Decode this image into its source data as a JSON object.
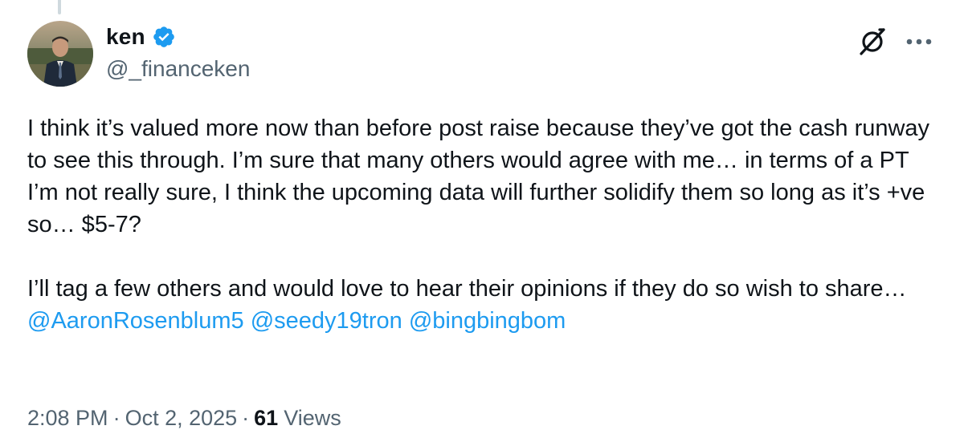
{
  "author": {
    "display_name": "ken",
    "handle": "@_financeken",
    "verified": true
  },
  "tweet": {
    "paragraph1": "I think it’s valued more now than before post raise because they’ve got the cash runway to see this through. I’m sure that many others would agree with me… in terms of a PT I’m not really sure, I think the upcoming data will further solidify them so long as it’s +ve so… $5-7?",
    "paragraph2_text": "I’ll tag a few others and would love to hear their opinions if they do so wish to share… ",
    "mentions": [
      "@AaronRosenblum5",
      "@seedy19tron",
      "@bingbingbom"
    ]
  },
  "meta": {
    "time": "2:08 PM",
    "separator": "·",
    "date": "Oct 2, 2025",
    "views_count": "61",
    "views_label": "Views"
  },
  "icons": {
    "verified": "verified-badge-icon",
    "grok": "grok-icon",
    "more": "more-options-icon"
  },
  "colors": {
    "accent": "#1d9bf0",
    "secondary_text": "#536471",
    "primary_text": "#0f1419",
    "thread_line": "#cfd9de"
  }
}
